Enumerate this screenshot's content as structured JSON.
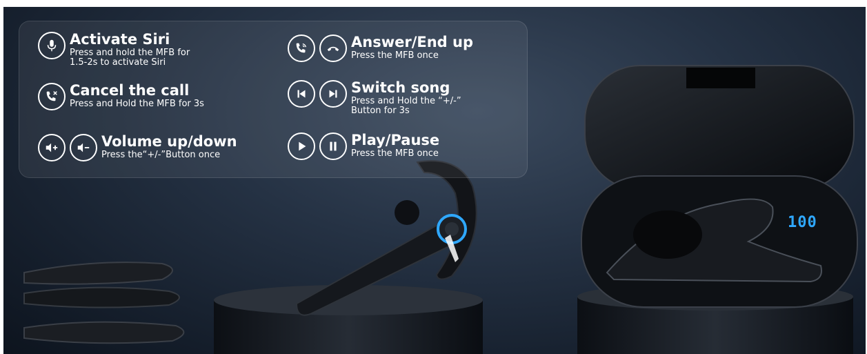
{
  "controls": [
    {
      "id": "siri",
      "icons": [
        "microphone-icon"
      ],
      "title": "Activate Siri",
      "desc": "Press and hold the MFB for\n1.5-2s to activate Siri"
    },
    {
      "id": "cancel",
      "icons": [
        "phone-cancel-icon"
      ],
      "title": "Cancel the call",
      "desc": "Press and Hold the MFB for 3s"
    },
    {
      "id": "volume",
      "icons": [
        "volume-up-icon",
        "volume-down-icon"
      ],
      "title": "Volume up/down",
      "desc": "Press the“+/-”Button once"
    },
    {
      "id": "answer",
      "icons": [
        "phone-ringing-icon",
        "hang-up-icon"
      ],
      "title": "Answer/End up",
      "desc": "Press the MFB once"
    },
    {
      "id": "switch",
      "icons": [
        "previous-track-icon",
        "next-track-icon"
      ],
      "title": "Switch song",
      "desc": "Press and Hold the “+/-”\nButton for 3s"
    },
    {
      "id": "play",
      "icons": [
        "play-icon",
        "pause-icon"
      ],
      "title": "Play/Pause",
      "desc": "Press the MFB once"
    }
  ],
  "case_display": {
    "battery_readout": "100",
    "color": "#2fa8ff"
  },
  "colors": {
    "accent": "#2fa8ff",
    "text": "#ffffff"
  }
}
